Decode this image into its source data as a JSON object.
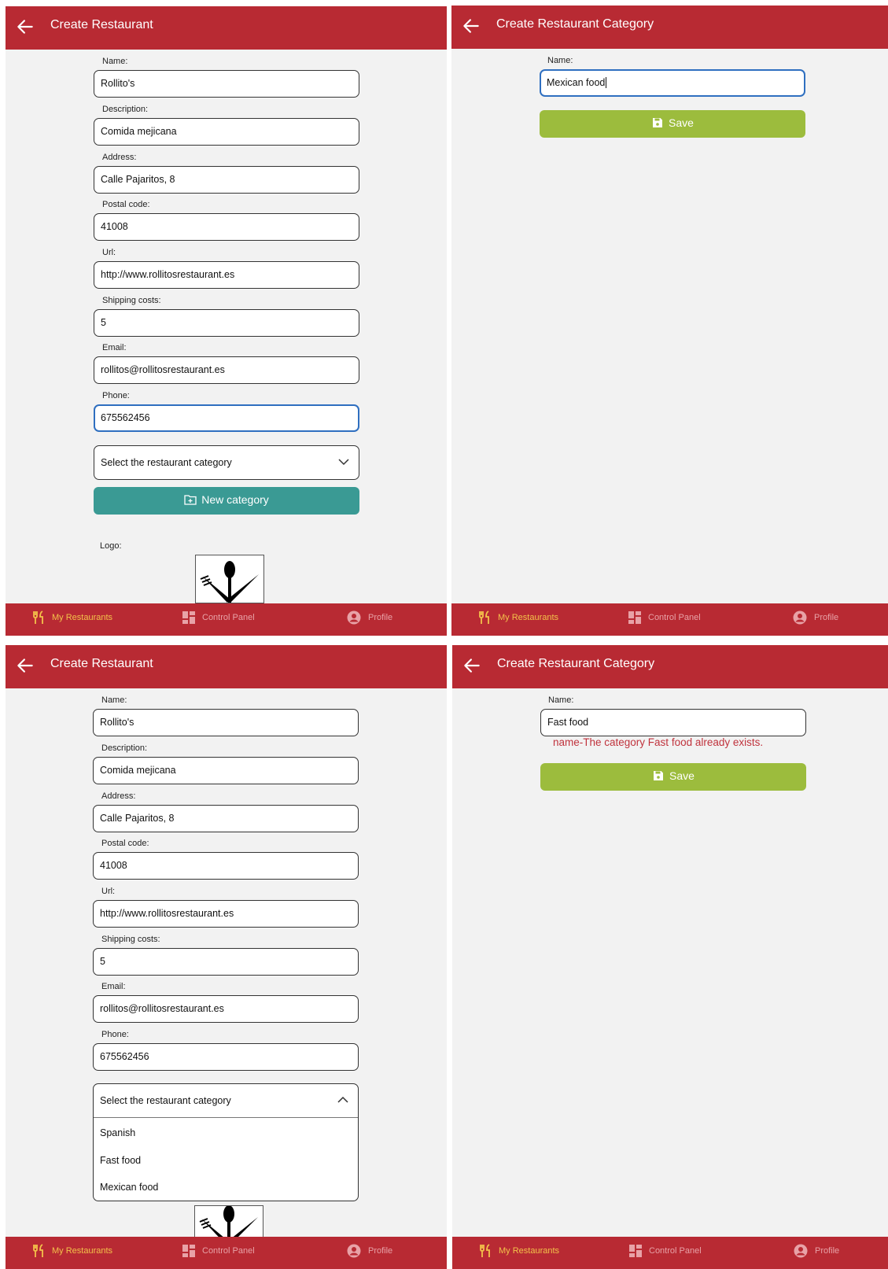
{
  "panels": {
    "create_restaurant": {
      "title": "Create Restaurant",
      "fields": [
        {
          "label": "Name:",
          "value": "Rollito's"
        },
        {
          "label": "Description:",
          "value": "Comida mejicana"
        },
        {
          "label": "Address:",
          "value": "Calle Pajaritos, 8"
        },
        {
          "label": "Postal code:",
          "value": "41008"
        },
        {
          "label": "Url:",
          "value": "http://www.rollitosrestaurant.es"
        },
        {
          "label": "Shipping costs:",
          "value": "5"
        },
        {
          "label": "Email:",
          "value": "rollitos@rollitosrestaurant.es"
        },
        {
          "label": "Phone:",
          "value": "675562456"
        }
      ],
      "category_select": "Select the restaurant category",
      "category_options": [
        "Spanish",
        "Fast food",
        "Mexican food"
      ],
      "new_category_button": "New category",
      "logo_label": "Logo:"
    },
    "create_category": {
      "title": "Create Restaurant Category",
      "name_label": "Name:",
      "name_value_1": "Mexican food",
      "name_value_2": "Fast food",
      "error_message": "name-The category Fast food already exists.",
      "save_button": "Save"
    }
  },
  "tabbar": {
    "my_restaurants": "My Restaurants",
    "control_panel": "Control Panel",
    "profile": "Profile"
  },
  "colors": {
    "header": "#b82a33",
    "tab_active": "#f3c24a",
    "teal_button": "#3a9a94",
    "green_button": "#9cbc3d",
    "error": "#c0333d",
    "focus_border": "#2f6fc0"
  }
}
